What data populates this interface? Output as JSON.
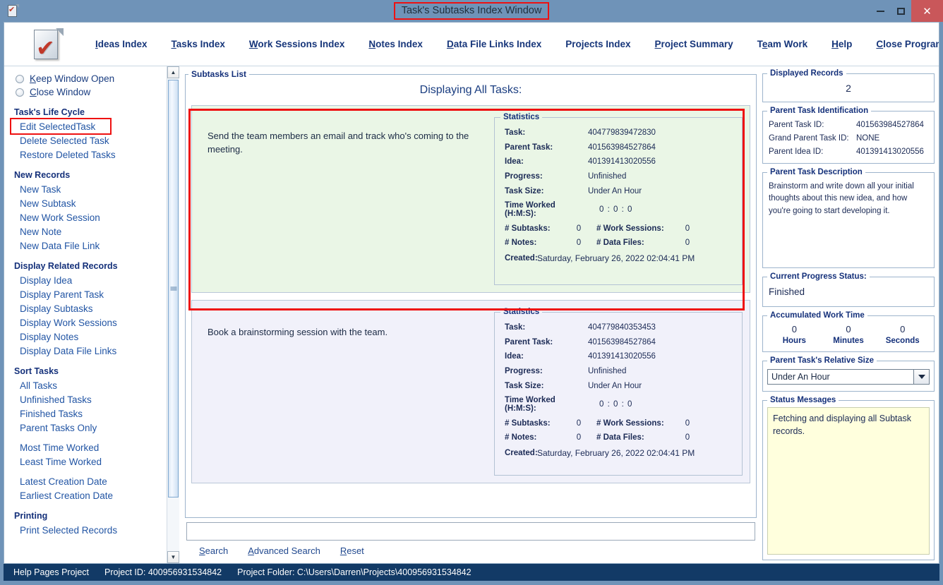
{
  "window": {
    "title": "Task's Subtasks Index Window",
    "title_highlight_color": "#ee1111",
    "icon": "document-check-icon",
    "minimize": "–",
    "maximize": "□",
    "close": "✕"
  },
  "menubar": {
    "logo": "document-check-logo",
    "items": [
      {
        "label": "Ideas Index",
        "accel": "I"
      },
      {
        "label": "Tasks Index",
        "accel": "T"
      },
      {
        "label": "Work Sessions Index",
        "accel": "W"
      },
      {
        "label": "Notes Index",
        "accel": "N"
      },
      {
        "label": "Data File Links Index",
        "accel": "D"
      },
      {
        "label": "Projects Index",
        "accel": ""
      },
      {
        "label": "Project Summary",
        "accel": "P"
      },
      {
        "label": "Team Work",
        "accel": "e"
      },
      {
        "label": "Help",
        "accel": "H"
      },
      {
        "label": "Close Program",
        "accel": "C"
      }
    ]
  },
  "sidebar": {
    "radios": [
      {
        "label": "Keep Window Open",
        "selected": false
      },
      {
        "label": "Close Window",
        "selected": false
      }
    ],
    "groups": [
      {
        "heading": "Task's Life Cycle",
        "items": [
          {
            "label": "Edit SelectedTask",
            "highlighted": true
          },
          {
            "label": "Delete Selected Task",
            "highlighted": false
          },
          {
            "label": "Restore Deleted Tasks",
            "highlighted": false
          }
        ]
      },
      {
        "heading": "New Records",
        "items": [
          {
            "label": "New Task"
          },
          {
            "label": "New Subtask"
          },
          {
            "label": "New Work Session"
          },
          {
            "label": "New Note"
          },
          {
            "label": "New Data File Link"
          }
        ]
      },
      {
        "heading": "Display Related Records",
        "items": [
          {
            "label": "Display Idea"
          },
          {
            "label": "Display Parent Task"
          },
          {
            "label": "Display Subtasks"
          },
          {
            "label": "Display Work Sessions"
          },
          {
            "label": "Display Notes"
          },
          {
            "label": "Display Data File Links"
          }
        ]
      },
      {
        "heading": "Sort Tasks",
        "items": [
          {
            "label": "All Tasks"
          },
          {
            "label": "Unfinished Tasks"
          },
          {
            "label": "Finished Tasks"
          },
          {
            "label": "Parent Tasks Only"
          },
          {
            "label": "Most Time Worked",
            "gap_before": true
          },
          {
            "label": "Least Time Worked"
          },
          {
            "label": "Latest Creation Date",
            "gap_before": true
          },
          {
            "label": "Earliest Creation Date"
          }
        ]
      },
      {
        "heading": "Printing",
        "items": [
          {
            "label": "Print Selected Records"
          }
        ]
      }
    ]
  },
  "main": {
    "panel_legend": "Subtasks List",
    "list_title": "Displaying All Tasks:",
    "stats_legend": "Statistics",
    "labels": {
      "task": "Task:",
      "parent_task": "Parent Task:",
      "idea": "Idea:",
      "progress": "Progress:",
      "task_size": "Task Size:",
      "time_worked": "Time Worked (H:M:S):",
      "subtasks": "# Subtasks:",
      "work_sessions": "# Work Sessions:",
      "notes": "# Notes:",
      "data_files": "# Data Files:",
      "created": "Created:"
    },
    "records": [
      {
        "description": "Send the team members an email and track who's coming to the meeting.",
        "selected": true,
        "bg": "#eaf6e6",
        "task": "404779839472830",
        "parent_task": "401563984527864",
        "idea": "401391413020556",
        "progress": "Unfinished",
        "task_size": "Under An Hour",
        "time_worked": "0  :  0  :  0",
        "subtasks": "0",
        "work_sessions": "0",
        "notes": "0",
        "data_files": "0",
        "created": "Saturday, February 26, 2022   02:04:41 PM"
      },
      {
        "description": "Book a brainstorming session with the team.",
        "selected": false,
        "bg": "#f1f1fa",
        "task": "404779840353453",
        "parent_task": "401563984527864",
        "idea": "401391413020556",
        "progress": "Unfinished",
        "task_size": "Under An Hour",
        "time_worked": "0  :  0  :  0",
        "subtasks": "0",
        "work_sessions": "0",
        "notes": "0",
        "data_files": "0",
        "created": "Saturday, February 26, 2022   02:04:41 PM"
      }
    ]
  },
  "search": {
    "value": "",
    "placeholder": "",
    "links": [
      "Search",
      "Advanced Search",
      "Reset"
    ]
  },
  "right": {
    "displayed_records": {
      "legend": "Displayed Records",
      "value": "2"
    },
    "parent_task_identification": {
      "legend": "Parent Task Identification",
      "rows": [
        {
          "label": "Parent Task ID:",
          "value": "401563984527864"
        },
        {
          "label": "Grand Parent Task ID:",
          "value": "NONE"
        },
        {
          "label": "Parent Idea ID:",
          "value": "401391413020556"
        }
      ]
    },
    "parent_task_description": {
      "legend": "Parent Task Description",
      "text": "Brainstorm and write down all your initial thoughts about this new idea, and how you're going to start developing it."
    },
    "current_progress_status": {
      "legend": "Current Progress Status:",
      "value": "Finished"
    },
    "accumulated_work_time": {
      "legend": "Accumulated Work Time",
      "hours": "0",
      "minutes": "0",
      "seconds": "0",
      "hours_label": "Hours",
      "minutes_label": "Minutes",
      "seconds_label": "Seconds"
    },
    "relative_size": {
      "legend": "Parent Task's Relative Size",
      "value": "Under An Hour"
    },
    "status_messages": {
      "legend": "Status Messages",
      "text": "Fetching and displaying all Subtask records."
    }
  },
  "statusbar": {
    "project": "Help Pages Project",
    "project_id_label": "Project ID:",
    "project_id": "400956931534842",
    "project_folder_label": "Project Folder:",
    "project_folder": "C:\\Users\\Darren\\Projects\\400956931534842"
  }
}
